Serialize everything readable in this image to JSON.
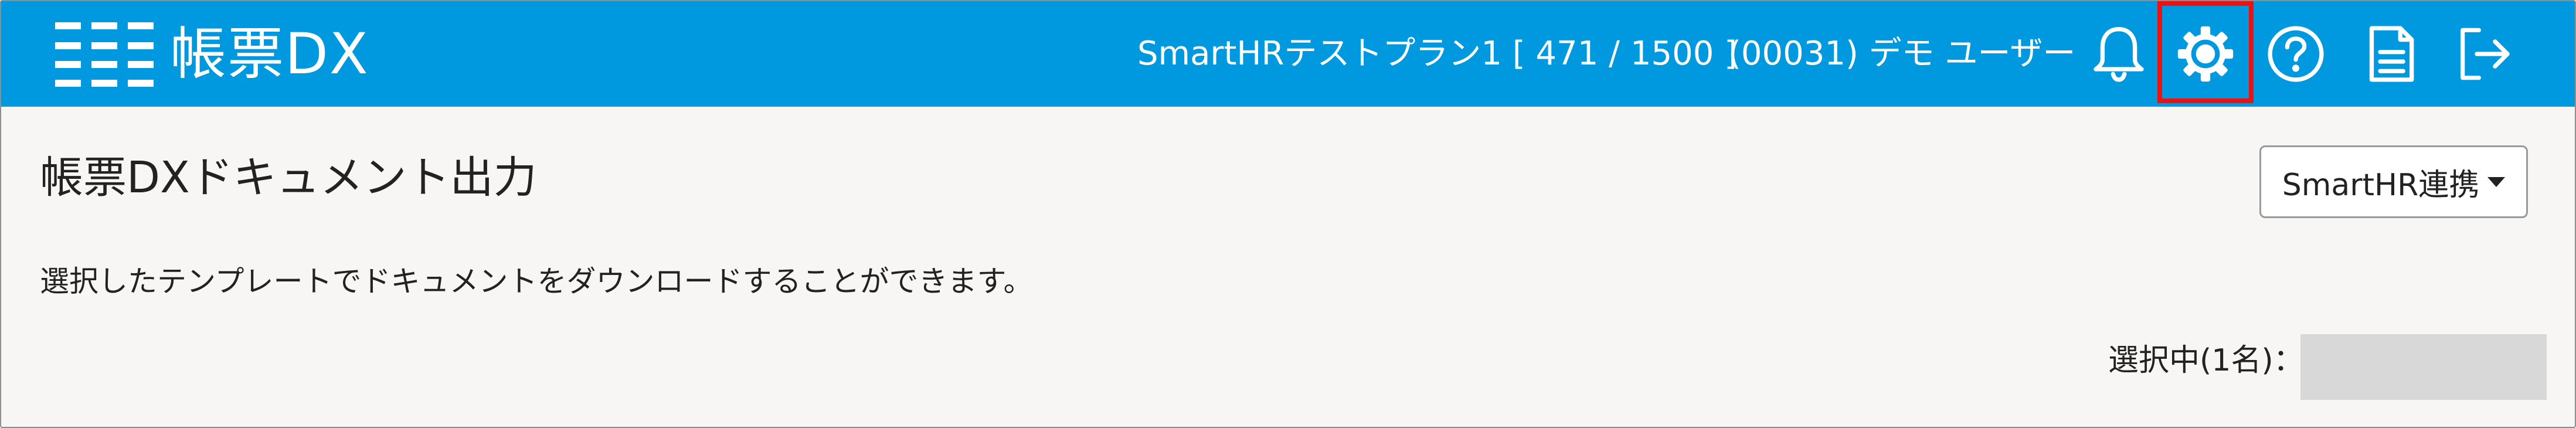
{
  "header": {
    "app_name": "帳票DX",
    "plan_info": "SmartHRテストプラン1 [ 471 / 1500 ]",
    "user_info": "(00031) デモ ユーザー",
    "icons": [
      "menu-lines-icon",
      "bell-icon",
      "gear-icon",
      "help-icon",
      "document-icon",
      "logout-icon"
    ],
    "highlighted_icon": "gear-icon"
  },
  "main": {
    "title": "帳票DXドキュメント出力",
    "integration_button": "SmartHR連携",
    "description": "選択したテンプレートでドキュメントをダウンロードすることができます。",
    "selected_label": "選択中(1名)："
  },
  "colors": {
    "header_bg": "#0099e0",
    "page_bg": "#f7f6f5",
    "highlight": "#ee1111",
    "placeholder": "#d8d8d8"
  }
}
